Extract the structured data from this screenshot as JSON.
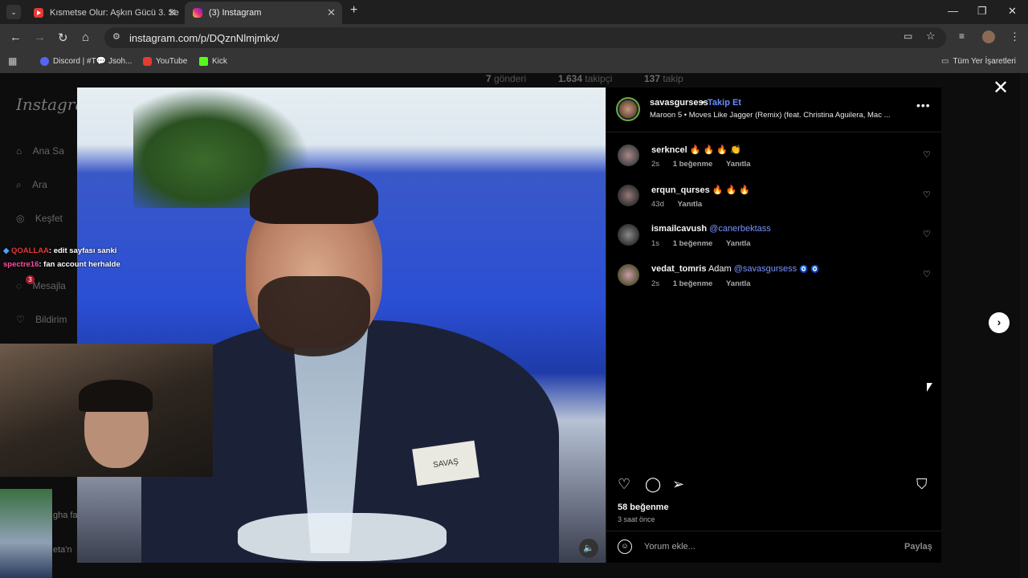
{
  "browser": {
    "tabs": [
      {
        "title": "Kısmetse Olur: Aşkın Gücü 3. Se",
        "icon": "youtube-icon",
        "active": false
      },
      {
        "title": "(3) Instagram",
        "icon": "instagram-icon",
        "active": true
      }
    ],
    "url": "instagram.com/p/DQznNlmjmkx/",
    "bookmarks": [
      {
        "label": "Discord | #T💬 Jsoh...",
        "icon": "discord-icon"
      },
      {
        "label": "YouTube",
        "icon": "youtube-icon"
      },
      {
        "label": "Kick",
        "icon": "kick-icon"
      }
    ],
    "all_bookmarks": "Tüm Yer İşaretleri"
  },
  "background_profile": {
    "posts": "7",
    "posts_label": "gönderi",
    "followers": "1.634",
    "followers_label": "takipçi",
    "following": "137",
    "following_label": "takip",
    "logo": "Instagram",
    "nav": [
      "Ana Sa",
      "Ara",
      "Keşfet",
      "Mesajla",
      "Bildirim"
    ],
    "notif_count": "3",
    "bg_text_1": "gha fa",
    "bg_text_2": "eta'n"
  },
  "stream_chat": [
    {
      "user": "QOALLAA",
      "text": ": edit sayfası sanki"
    },
    {
      "user": "spectre16",
      "text": ": fan account herhalde"
    }
  ],
  "video": {
    "nametag": "SAVAŞ"
  },
  "post": {
    "username": "savasgursess",
    "separator": "•",
    "follow_label": "Takip Et",
    "song": "Maroon 5 • Moves Like Jagger (Remix) (feat. Christina Aguilera, Mac ...",
    "comments": [
      {
        "user": "serkncel",
        "text": "🔥 🔥 🔥 👏",
        "mention": "",
        "time": "2s",
        "likes": "1 beğenme",
        "reply": "Yanıtla"
      },
      {
        "user": "erqun_qurses",
        "text": "🔥 🔥 🔥",
        "mention": "",
        "time": "43d",
        "likes": "",
        "reply": "Yanıtla"
      },
      {
        "user": "ismailcavush",
        "text": "",
        "mention": "@canerbektass",
        "time": "1s",
        "likes": "1 beğenme",
        "reply": "Yanıtla"
      },
      {
        "user": "vedat_tomris",
        "text": "Adam",
        "mention": "@savasgursess",
        "extra": "🧿 🧿",
        "time": "2s",
        "likes": "1 beğenme",
        "reply": "Yanıtla"
      }
    ],
    "likes": "58 beğenme",
    "posted": "3 saat önce",
    "comment_placeholder": "Yorum ekle...",
    "share_label": "Paylaş"
  }
}
